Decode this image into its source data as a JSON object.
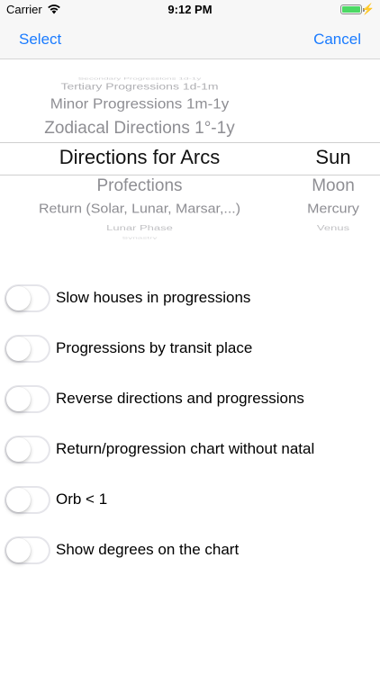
{
  "status_bar": {
    "carrier": "Carrier",
    "time": "9:12 PM",
    "battery_color": "#4cd964"
  },
  "nav": {
    "select": "Select",
    "cancel": "Cancel",
    "accent_color": "#1a7bff"
  },
  "picker": {
    "column_a": {
      "selected": "Directions for Arcs",
      "items": [
        "Secondary Progressions 1d-1y",
        "Tertiary Progressions 1d-1m",
        "Minor Progressions 1m-1y",
        "Zodiacal Directions 1°-1y",
        "Directions for Arcs",
        "Profections",
        "Return (Solar, Lunar, Marsar,...)",
        "Lunar Phase",
        "Synastry"
      ]
    },
    "column_b": {
      "selected": "Sun",
      "items": [
        "",
        "",
        "",
        "",
        "Sun",
        "Moon",
        "Mercury",
        "Venus",
        ""
      ]
    }
  },
  "options": [
    {
      "label": "Slow houses in progressions",
      "on": false
    },
    {
      "label": "Progressions by transit place",
      "on": false
    },
    {
      "label": "Reverse directions and progressions",
      "on": false
    },
    {
      "label": "Return/progression chart without natal",
      "on": false
    },
    {
      "label": "Orb < 1",
      "on": false
    },
    {
      "label": "Show degrees on the chart",
      "on": false
    }
  ]
}
